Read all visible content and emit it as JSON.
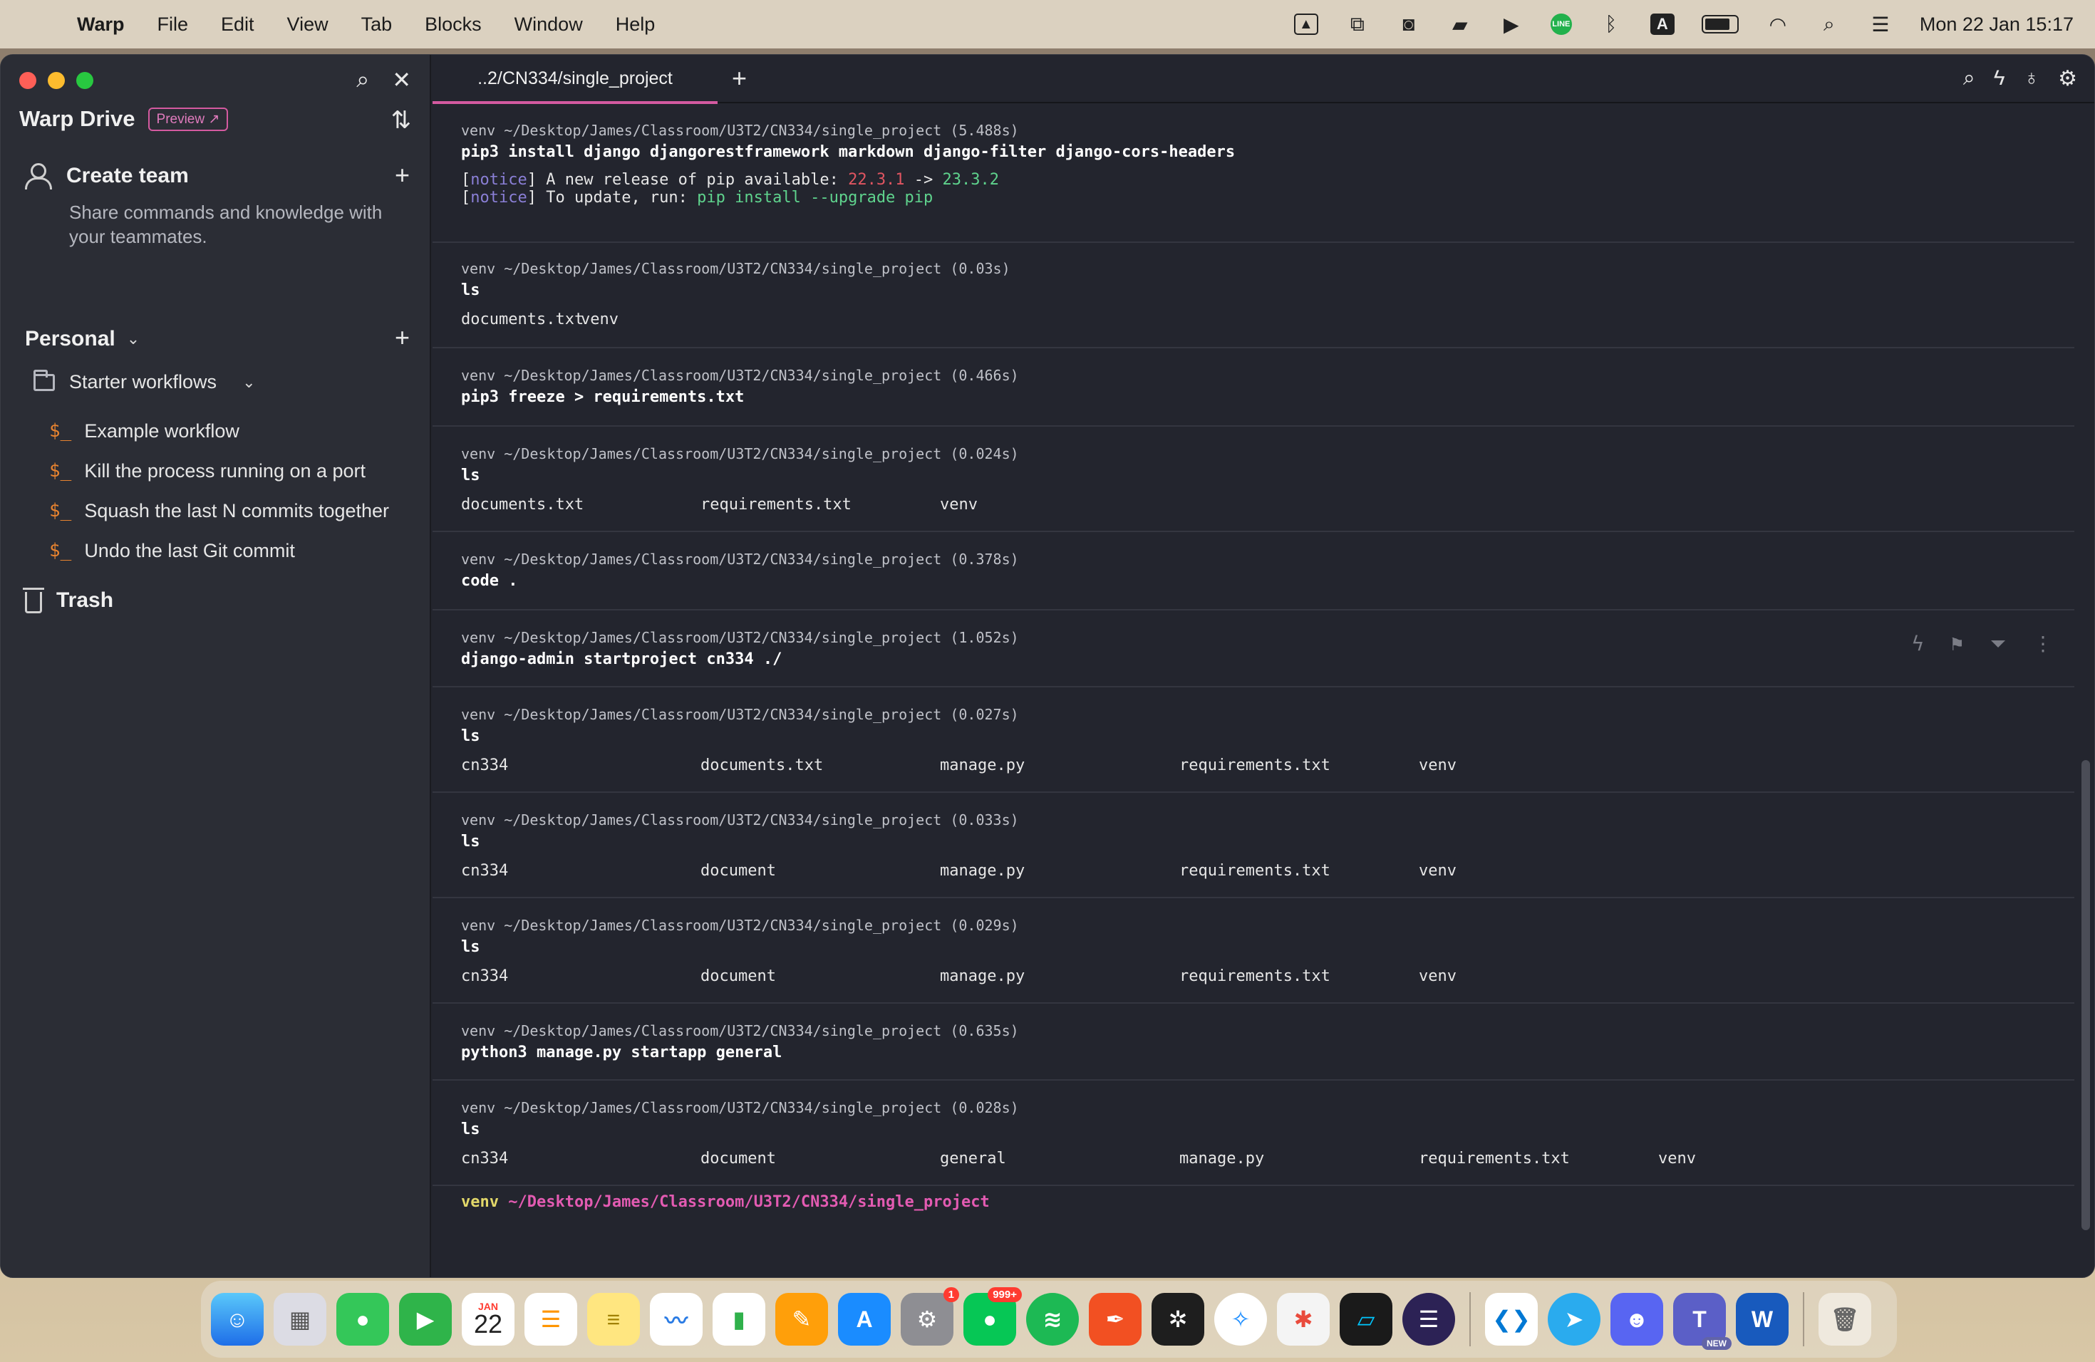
{
  "menubar": {
    "app_name": "Warp",
    "items": [
      "File",
      "Edit",
      "View",
      "Tab",
      "Blocks",
      "Window",
      "Help"
    ],
    "input_letter": "A",
    "line_label": "LINE",
    "clock": "Mon 22 Jan  15:17"
  },
  "sidebar": {
    "title": "Warp Drive",
    "preview_badge": "Preview",
    "create_team": {
      "label": "Create team",
      "description": "Share commands and knowledge with your teammates."
    },
    "personal_label": "Personal",
    "folder_label": "Starter workflows",
    "workflow_glyph": "$_",
    "workflows": [
      "Example workflow",
      "Kill the process running on a port",
      "Squash the last N commits together",
      "Undo the last Git commit"
    ],
    "trash_label": "Trash"
  },
  "tabbar": {
    "active_tab": "..2/CN334/single_project"
  },
  "terminal": {
    "blocks": [
      {
        "prompt": "venv ~/Desktop/James/Classroom/U3T2/CN334/single_project (5.488s)",
        "cmd": "pip3 install django djangorestframework markdown django-filter django-cors-headers",
        "notice": {
          "tag": "notice",
          "line1_prefix": "A new release of pip available: ",
          "old_version": "22.3.1",
          "arrow": " -> ",
          "new_version": "23.3.2",
          "line2_prefix": "To update, run: ",
          "update_cmd": "pip install --upgrade pip"
        }
      },
      {
        "prompt": "venv ~/Desktop/James/Classroom/U3T2/CN334/single_project (0.03s)",
        "cmd": "ls",
        "output": [
          "documents.txt",
          "venv"
        ]
      },
      {
        "prompt": "venv ~/Desktop/James/Classroom/U3T2/CN334/single_project (0.466s)",
        "cmd": "pip3 freeze > requirements.txt"
      },
      {
        "prompt": "venv ~/Desktop/James/Classroom/U3T2/CN334/single_project (0.024s)",
        "cmd": "ls",
        "output": [
          "documents.txt",
          "requirements.txt",
          "venv"
        ]
      },
      {
        "prompt": "venv ~/Desktop/James/Classroom/U3T2/CN334/single_project (0.378s)",
        "cmd": "code ."
      },
      {
        "prompt": "venv ~/Desktop/James/Classroom/U3T2/CN334/single_project (1.052s)",
        "cmd": "django-admin startproject cn334 ./"
      },
      {
        "prompt": "venv ~/Desktop/James/Classroom/U3T2/CN334/single_project (0.027s)",
        "cmd": "ls",
        "output": [
          "cn334",
          "documents.txt",
          "manage.py",
          "requirements.txt",
          "venv"
        ]
      },
      {
        "prompt": "venv ~/Desktop/James/Classroom/U3T2/CN334/single_project (0.033s)",
        "cmd": "ls",
        "output": [
          "cn334",
          "document",
          "manage.py",
          "requirements.txt",
          "venv"
        ]
      },
      {
        "prompt": "venv ~/Desktop/James/Classroom/U3T2/CN334/single_project (0.029s)",
        "cmd": "ls",
        "output": [
          "cn334",
          "document",
          "manage.py",
          "requirements.txt",
          "venv"
        ]
      },
      {
        "prompt": "venv ~/Desktop/James/Classroom/U3T2/CN334/single_project (0.635s)",
        "cmd": "python3 manage.py startapp general"
      },
      {
        "prompt": "venv ~/Desktop/James/Classroom/U3T2/CN334/single_project (0.028s)",
        "cmd": "ls",
        "output": [
          "cn334",
          "document",
          "general",
          "manage.py",
          "requirements.txt",
          "venv"
        ]
      }
    ],
    "input_prompt": {
      "venv": "venv",
      "path": "~/Desktop/James/Classroom/U3T2/CN334/single_project"
    }
  },
  "dock": {
    "calendar_month": "JAN",
    "calendar_day": "22",
    "settings_badge": "1",
    "line_badge": "999+",
    "teams_badge": "NEW",
    "word_letter": "W"
  },
  "colors": {
    "accent": "#d45aa0",
    "prompt_path": "#e35bb2",
    "venv": "#e2d86a",
    "old_version": "#e05561",
    "new_version": "#5fd38d"
  }
}
